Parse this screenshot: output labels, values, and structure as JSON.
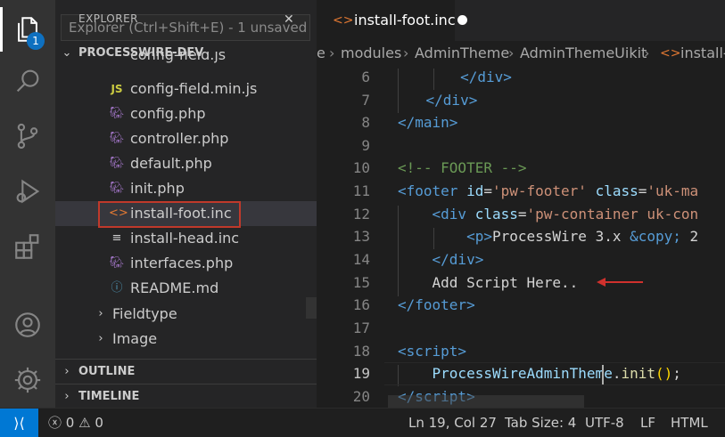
{
  "activity": {
    "explorer_badge": "1"
  },
  "sidebar": {
    "title": "EXPLORER",
    "filter_placeholder": "Explorer (Ctrl+Shift+E) - 1 unsaved file",
    "root_label": "PROCESSWIRE-DEV",
    "files": [
      {
        "label": "config-field.js",
        "icon": "JS"
      },
      {
        "label": "config-field.min.js",
        "icon": "JS"
      },
      {
        "label": "config.php",
        "icon": "php-icon"
      },
      {
        "label": "controller.php",
        "icon": "php-icon"
      },
      {
        "label": "default.php",
        "icon": "php-icon"
      },
      {
        "label": "init.php",
        "icon": "php-icon"
      },
      {
        "label": "install-foot.inc",
        "icon": "<>"
      },
      {
        "label": "install-head.inc",
        "icon": "lines-icon"
      },
      {
        "label": "interfaces.php",
        "icon": "php-icon"
      },
      {
        "label": "README.md",
        "icon": "info-icon"
      }
    ],
    "folders": [
      {
        "label": "Fieldtype"
      },
      {
        "label": "Image"
      }
    ],
    "sections": [
      {
        "label": "OUTLINE"
      },
      {
        "label": "TIMELINE"
      }
    ]
  },
  "editor": {
    "tab": {
      "label": "install-foot.inc"
    },
    "breadcrumb": [
      "e",
      "modules",
      "AdminTheme",
      "AdminThemeUikit",
      "install-"
    ],
    "line_numbers": [
      "6",
      "7",
      "8",
      "9",
      "10",
      "11",
      "12",
      "13",
      "14",
      "15",
      "16",
      "17",
      "18",
      "19",
      "20"
    ],
    "current_line": "19"
  },
  "status": {
    "errors": "0",
    "warnings": "0",
    "position": "Ln 19, Col 27",
    "tab_size": "Tab Size: 4",
    "encoding": "UTF-8",
    "eol": "LF",
    "language": "HTML"
  },
  "colors": {
    "accent": "#0078d4",
    "selection_outline": "#c0392b",
    "annotation_arrow": "#d0312d"
  }
}
